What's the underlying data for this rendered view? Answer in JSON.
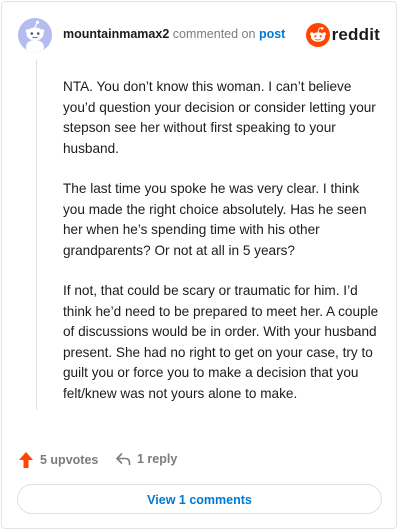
{
  "header": {
    "username": "mountainmamax2",
    "verb": "commented on",
    "post_link": "post",
    "brand": "reddit"
  },
  "comment": {
    "paragraphs": [
      "NTA. You don’t know this woman. I can’t believe you’d question your decision or consider letting your stepson see her without first speaking to your husband.",
      "The last time you spoke he was very clear. I think you made the right choice absolutely. Has he seen her when he’s spending time with his other grandparents? Or not at all in 5 years?",
      "If not, that could be scary or traumatic for him. I’d think he’d need to be prepared to meet her. A couple of discussions would be in order. With your husband present. She had no right to get on your case, try to guilt you or force you to make a decision that you felt/knew was not yours alone to make."
    ]
  },
  "actions": {
    "upvotes_label": "5 upvotes",
    "replies_label": "1 reply"
  },
  "view_comments_label": "View 1 comments",
  "colors": {
    "brand_orange": "#ff4500",
    "link_blue": "#0079d3",
    "upvote_orange": "#ff4500",
    "avatar_bg": "#b5bdf0"
  },
  "icons": {
    "avatar": "snoo-avatar-icon",
    "brand": "reddit-logo-icon",
    "upvote": "upvote-arrow-icon",
    "reply": "reply-arrow-icon"
  }
}
